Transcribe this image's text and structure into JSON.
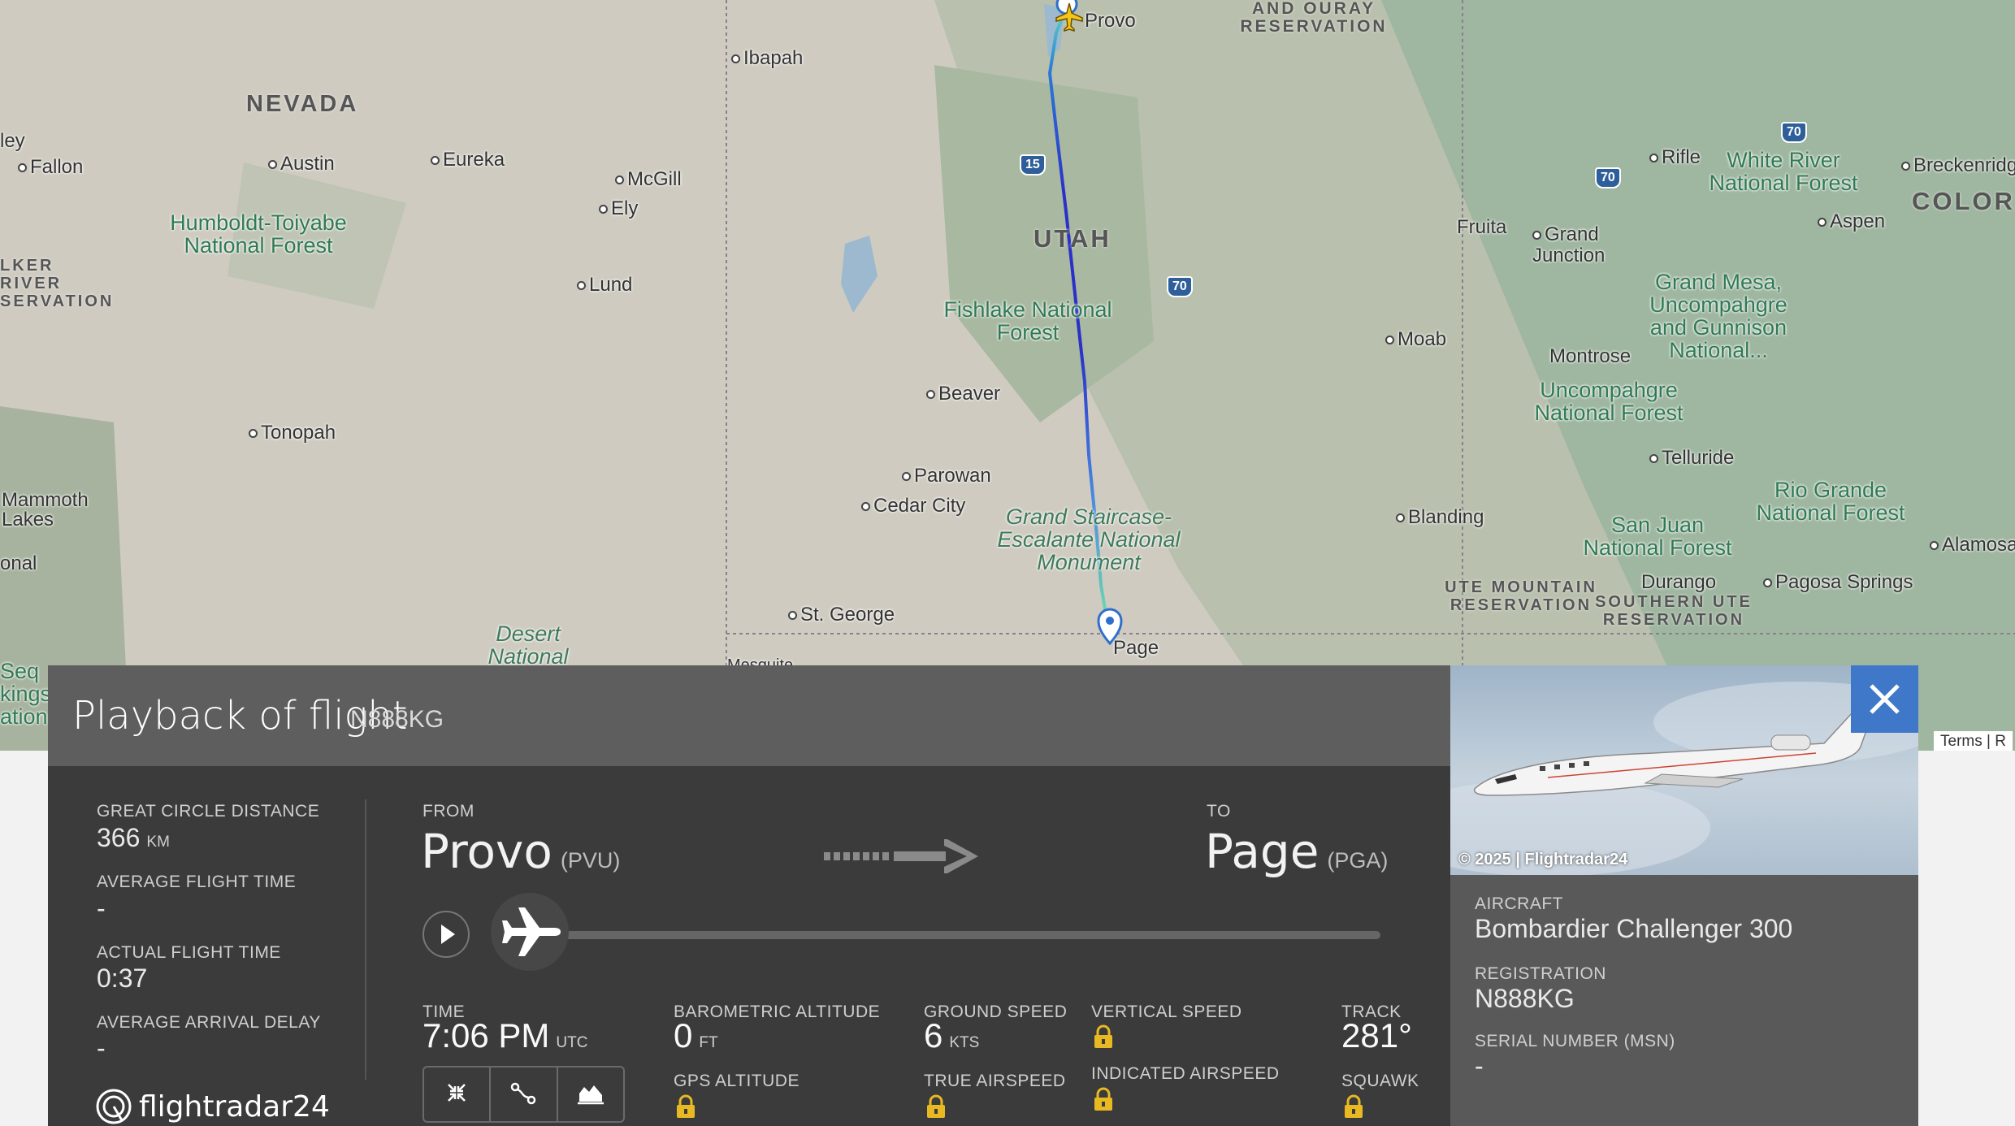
{
  "map": {
    "places": {
      "provo": "Provo",
      "ibapah": "Ibapah",
      "fallon": "Fallon",
      "austin": "Austin",
      "eureka": "Eureka",
      "mcgill": "McGill",
      "ely": "Ely",
      "lund": "Lund",
      "tonopah": "Tonopah",
      "mammoth": "Mammoth Lakes",
      "beaver": "Beaver",
      "parowan": "Parowan",
      "cedar_city": "Cedar City",
      "st_george": "St. George",
      "page": "Page",
      "moab": "Moab",
      "fruita": "Fruita",
      "grand_junction": "Grand Junction",
      "rifle": "Rifle",
      "aspen": "Aspen",
      "montrose": "Montrose",
      "telluride": "Telluride",
      "blanding": "Blanding",
      "durango": "Durango",
      "pagosa": "Pagosa Springs",
      "alamosa": "Alamosa",
      "breckenridge": "Breckenridg",
      "ley": "ley",
      "nal": "onal",
      "mesq": "Mesquite"
    },
    "regions": {
      "nevada": "NEVADA",
      "utah": "UTAH",
      "colorado": "COLORA",
      "ouray": "AND OURAY RESERVATION",
      "walker": "LKER RIVER SERVATION",
      "ute_mountain": "UTE MOUNTAIN RESERVATION",
      "southern_ute": "SOUTHERN UTE RESERVATION"
    },
    "forests": {
      "humboldt": "Humboldt-Toiyabe National Forest",
      "fishlake": "Fishlake National Forest",
      "grand_staircase": "Grand Staircase-Escalante National Monument",
      "white_river": "White River National Forest",
      "gmug": "Grand Mesa, Uncompahgre and Gunnison National...",
      "uncompahgre": "Uncompahgre National Forest",
      "san_juan": "San Juan National Forest",
      "rio_grande": "Rio Grande National Forest",
      "desert": "Desert National",
      "seq": "Seq kings ation"
    },
    "highways": [
      "15",
      "70",
      "70",
      "70"
    ],
    "terms": "Terms",
    "terms_extra": "R",
    "route_color_start": "#5bd6c0",
    "route_color_mid": "#2a30c8"
  },
  "panel": {
    "title": "Playback of flight",
    "flight_id": "N888KG",
    "stats": {
      "gcd_label": "GREAT CIRCLE DISTANCE",
      "gcd_value": "366",
      "gcd_unit": "KM",
      "aft_label": "AVERAGE FLIGHT TIME",
      "aft_value": "-",
      "act_label": "ACTUAL FLIGHT TIME",
      "act_value": "0:37",
      "aad_label": "AVERAGE ARRIVAL DELAY",
      "aad_value": "-"
    },
    "from_label": "FROM",
    "from_city": "Provo",
    "from_code": "(PVU)",
    "to_label": "TO",
    "to_city": "Page",
    "to_code": "(PGA)",
    "progress": 0.0,
    "metrics": {
      "time_label": "TIME",
      "time_value": "7:06 PM",
      "time_unit": "UTC",
      "baro_label": "BAROMETRIC ALTITUDE",
      "baro_value": "0",
      "baro_unit": "FT",
      "gps_label": "GPS ALTITUDE",
      "gs_label": "GROUND SPEED",
      "gs_value": "6",
      "gs_unit": "KTS",
      "tas_label": "TRUE AIRSPEED",
      "vs_label": "VERTICAL SPEED",
      "ias_label": "INDICATED AIRSPEED",
      "track_label": "TRACK",
      "track_value": "281°",
      "squawk_label": "SQUAWK"
    },
    "logo_text": "flightradar24"
  },
  "aircraft": {
    "photo_credit": "© 2025 | Flightradar24",
    "aircraft_label": "AIRCRAFT",
    "aircraft_value": "Bombardier Challenger 300",
    "registration_label": "REGISTRATION",
    "registration_value": "N888KG",
    "msn_label": "SERIAL NUMBER (MSN)",
    "msn_value": "-"
  }
}
